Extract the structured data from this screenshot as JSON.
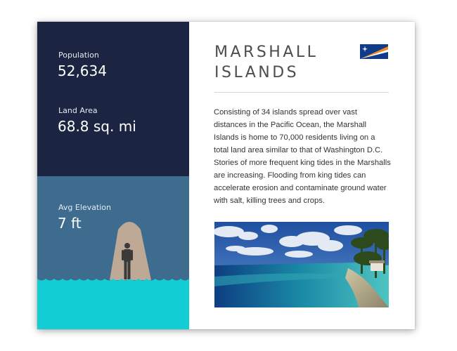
{
  "stats": {
    "population_label": "Population",
    "population_value": "52,634",
    "land_area_label": "Land Area",
    "land_area_value": "68.8 sq. mi",
    "elevation_label": "Avg Elevation",
    "elevation_value": "7 ft"
  },
  "header": {
    "title_line1": "MARSHALL",
    "title_line2": "ISLANDS",
    "flag_icon": "marshall-islands-flag-icon"
  },
  "description": "Consisting of 34 islands spread over vast distances in the Pacific Ocean, the Marshall Islands is home to 70,000 residents living on a total land area similar to that of Washington D.C.  Stories of more frequent king tides in the Marshalls are increasing.  Flooding from king tides can accelerate erosion and contaminate ground water with salt, killing trees and crops.",
  "colors": {
    "stats_bg": "#1b2541",
    "elevation_bg": "#3d6c8f",
    "water": "#13cdd4",
    "mound": "#bda995",
    "person": "#3a3a3a",
    "flag_blue": "#0f3b8a",
    "flag_orange": "#f08a1c"
  },
  "icons": {
    "elevation_figure": "person-on-mound-icon",
    "water": "water-waves-icon",
    "photo": "beach-photo"
  }
}
